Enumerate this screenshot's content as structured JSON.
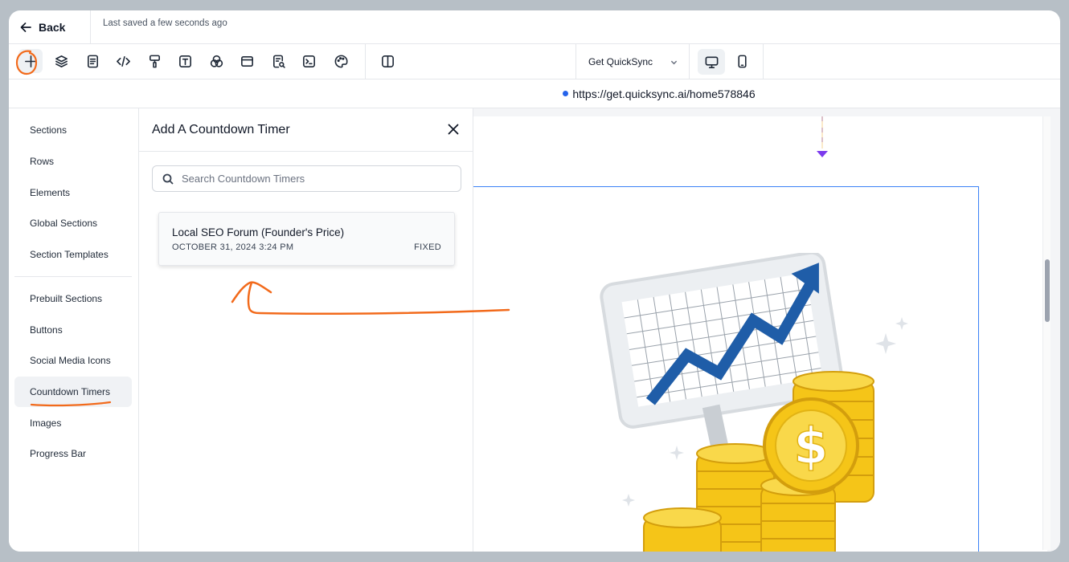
{
  "topbar": {
    "back_label": "Back",
    "save_status": "Last saved a few seconds ago"
  },
  "toolbar": {
    "tools": [
      {
        "name": "add",
        "icon": "plus-icon"
      },
      {
        "name": "layers",
        "icon": "layers-icon"
      },
      {
        "name": "pages",
        "icon": "document-icon"
      },
      {
        "name": "code",
        "icon": "code-icon"
      },
      {
        "name": "styles",
        "icon": "paint-roller-icon"
      },
      {
        "name": "typography",
        "icon": "text-icon"
      },
      {
        "name": "colors",
        "icon": "color-circles-icon"
      },
      {
        "name": "popup",
        "icon": "window-icon"
      },
      {
        "name": "seo",
        "icon": "seo-document-icon"
      },
      {
        "name": "tracking-code",
        "icon": "terminal-icon"
      },
      {
        "name": "theme",
        "icon": "palette-icon"
      },
      {
        "name": "split-view",
        "icon": "columns-icon"
      }
    ],
    "site_select": "Get QuickSync",
    "devices": [
      {
        "name": "desktop",
        "icon": "desktop-icon",
        "active": true
      },
      {
        "name": "mobile",
        "icon": "mobile-icon",
        "active": false
      }
    ]
  },
  "urlbar": {
    "url": "https://get.quicksync.ai/home578846"
  },
  "leftnav": {
    "items": [
      {
        "label": "Sections"
      },
      {
        "label": "Rows"
      },
      {
        "label": "Elements"
      },
      {
        "label": "Global Sections"
      },
      {
        "label": "Section Templates"
      },
      {
        "label": "Prebuilt Sections"
      },
      {
        "label": "Buttons"
      },
      {
        "label": "Social Media Icons"
      },
      {
        "label": "Countdown Timers",
        "active": true
      },
      {
        "label": "Images"
      },
      {
        "label": "Progress Bar"
      }
    ]
  },
  "panel": {
    "title": "Add A Countdown Timer",
    "search_placeholder": "Search Countdown Timers",
    "timers": [
      {
        "name": "Local SEO Forum (Founder's Price)",
        "date": "OCTOBER 31, 2024 3:24 PM",
        "type": "FIXED"
      }
    ]
  },
  "colors": {
    "accent": "#3b82f6",
    "annotation": "#f26a1b",
    "drop_indicator": "#7c3aed",
    "coin_gold": "#f5c518"
  }
}
